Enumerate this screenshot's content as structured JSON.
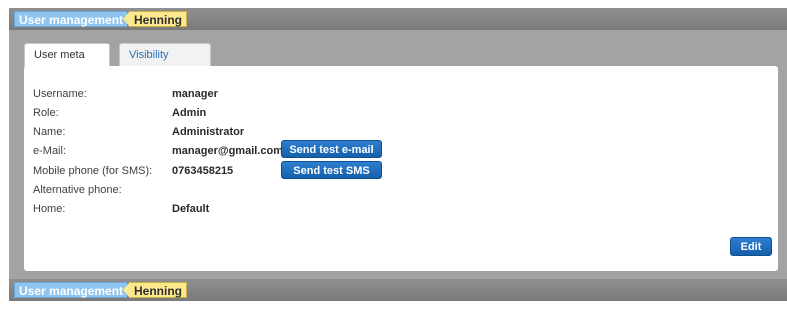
{
  "breadcrumb": {
    "section": "User management",
    "user": "Henning"
  },
  "tabs": [
    {
      "label": "User meta data",
      "active": true
    },
    {
      "label": "Visibility settings",
      "active": false
    }
  ],
  "fields": [
    {
      "label": "Username:",
      "value": "manager"
    },
    {
      "label": "Role:",
      "value": "Admin"
    },
    {
      "label": "Name:",
      "value": "Administrator"
    },
    {
      "label": "e-Mail:",
      "value": "manager@gmail.com"
    },
    {
      "label": "Mobile phone (for SMS):",
      "value": "0763458215"
    },
    {
      "label": "Alternative phone:",
      "value": ""
    },
    {
      "label": "Home:",
      "value": "Default"
    }
  ],
  "buttons": {
    "send_email": "Send test e-mail",
    "send_sms": "Send test SMS",
    "edit": "Edit"
  },
  "colors": {
    "button_blue": "#1f6fc0",
    "crumb_blue": "#8ec5f0",
    "crumb_yellow": "#fce98e",
    "frame_gray": "#a3a3a3"
  }
}
